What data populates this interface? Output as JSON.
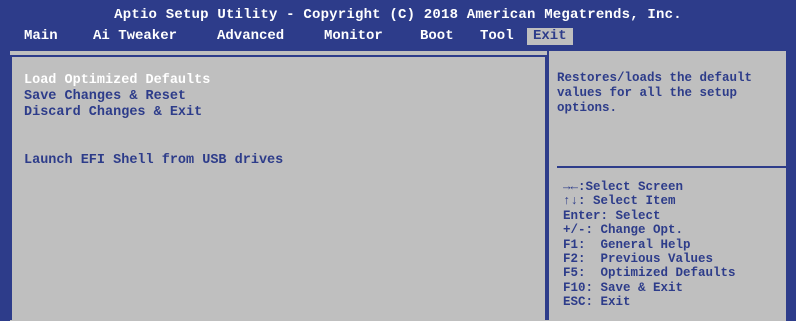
{
  "title": "Aptio Setup Utility - Copyright (C) 2018 American Megatrends, Inc.",
  "tabs": [
    "Main",
    "Ai Tweaker",
    "Advanced",
    "Monitor",
    "Boot",
    "Tool",
    "Exit"
  ],
  "active_tab": "Exit",
  "items": [
    {
      "label": "Load Optimized Defaults",
      "selected": true
    },
    {
      "label": "Save Changes & Reset",
      "selected": false
    },
    {
      "label": "Discard Changes & Exit",
      "selected": false
    },
    {
      "label": "Launch EFI Shell from USB drives",
      "selected": false
    }
  ],
  "help_text": "Restores/loads the default values for all the setup options.",
  "keys": [
    "→←:Select Screen",
    "↑↓: Select Item",
    "Enter: Select",
    "+/-: Change Opt.",
    "F1:  General Help",
    "F2:  Previous Values",
    "F5:  Optimized Defaults",
    "F10: Save & Exit",
    "ESC: Exit"
  ],
  "colors": {
    "bios_blue": "#2d3c8a",
    "panel_gray": "#bfbfbf",
    "highlight_white": "#ffffff"
  }
}
